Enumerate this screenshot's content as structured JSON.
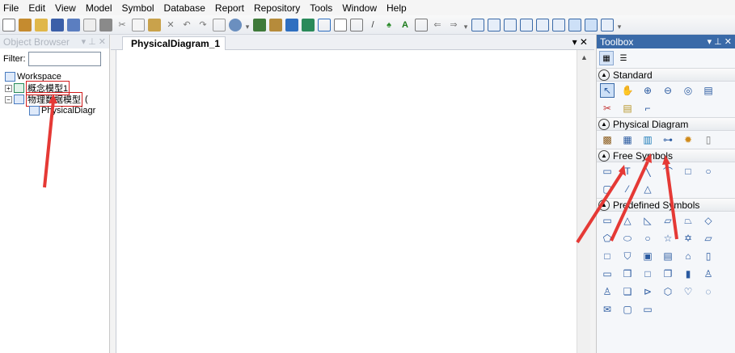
{
  "menu": [
    "File",
    "Edit",
    "View",
    "Model",
    "Symbol",
    "Database",
    "Report",
    "Repository",
    "Tools",
    "Window",
    "Help"
  ],
  "object_browser": {
    "title": "Object Browser",
    "controls": "▾ ⊥ ✕",
    "filter_label": "Filter:",
    "filter_value": "",
    "tree": {
      "root": "Workspace",
      "item1": "概念模型1",
      "item2": "物理数据模型",
      "item2_suffix": "(",
      "item2_child": "PhysicalDiagr"
    }
  },
  "editor": {
    "tab_label": "PhysicalDiagram_1",
    "tab_controls": "▾ ✕"
  },
  "toolbox": {
    "title": "Toolbox",
    "controls": "▾ ⊥ ✕",
    "sections": {
      "standard": "Standard",
      "physical": "Physical Diagram",
      "free": "Free Symbols",
      "predefined": "Predefined Symbols"
    }
  },
  "colors": {
    "annotation": "#e53935",
    "toolbox_title": "#3a6aa8"
  }
}
